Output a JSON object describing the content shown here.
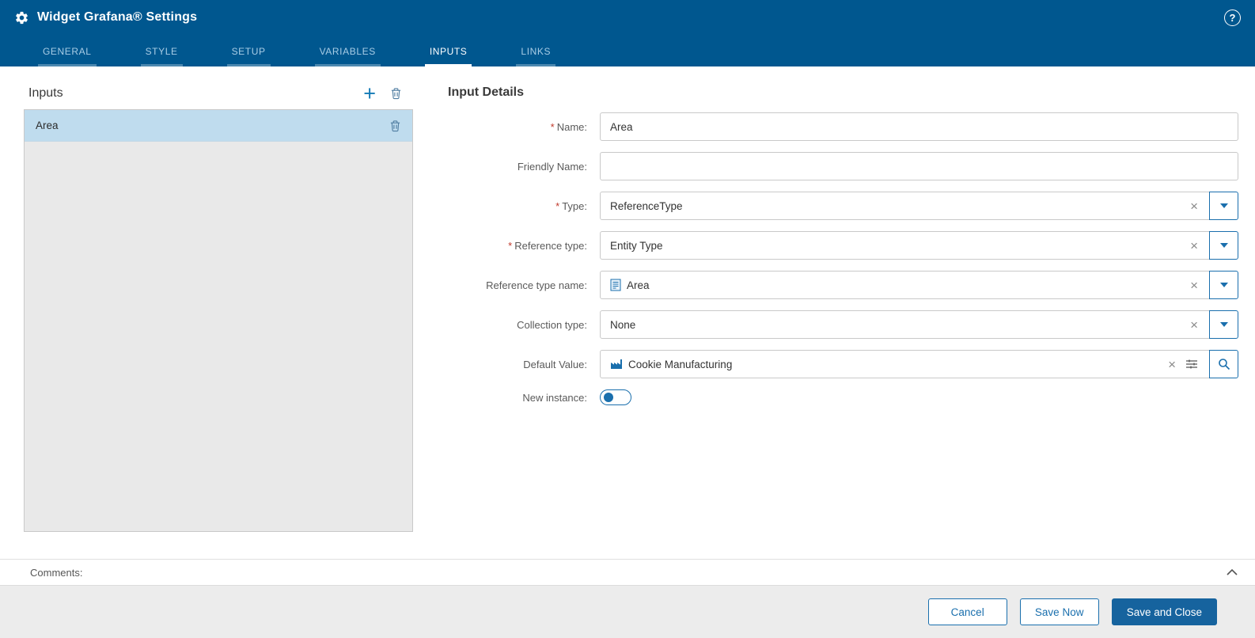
{
  "colors": {
    "header_bg": "#00578F",
    "accent_blue": "#1A6FAD",
    "selected_item_bg": "#BFDCEE",
    "primary_button_bg": "#16639E",
    "required_red": "#C0392B"
  },
  "header": {
    "title": "Widget Grafana® Settings",
    "help_label": "?"
  },
  "tabs": [
    {
      "label": "GENERAL",
      "active": false
    },
    {
      "label": "STYLE",
      "active": false
    },
    {
      "label": "SETUP",
      "active": false
    },
    {
      "label": "VARIABLES",
      "active": false
    },
    {
      "label": "INPUTS",
      "active": true
    },
    {
      "label": "LINKS",
      "active": false
    }
  ],
  "inputs_panel": {
    "title": "Inputs",
    "items": [
      {
        "label": "Area",
        "selected": true
      }
    ]
  },
  "details": {
    "title": "Input Details",
    "clear_symbol": "×",
    "fields": [
      {
        "label": "Name:",
        "required_marker": "*",
        "value": "Area",
        "control": "text"
      },
      {
        "label": "Friendly Name:",
        "required_marker": "",
        "value": "",
        "control": "text"
      },
      {
        "label": "Type:",
        "required_marker": "*",
        "value": "ReferenceType",
        "control": "combobox"
      },
      {
        "label": "Reference type:",
        "required_marker": "*",
        "value": "Entity Type",
        "control": "combobox"
      },
      {
        "label": "Reference type name:",
        "required_marker": "",
        "value": "Area",
        "control": "combobox",
        "icon": "datashape-icon"
      },
      {
        "label": "Collection type:",
        "required_marker": "",
        "value": "None",
        "control": "combobox"
      },
      {
        "label": "Default Value:",
        "required_marker": "",
        "value": "Cookie Manufacturing",
        "control": "entity-picker",
        "icon": "factory-icon"
      },
      {
        "label": "New instance:",
        "required_marker": "",
        "value": "off",
        "control": "toggle"
      }
    ]
  },
  "comments": {
    "label": "Comments:"
  },
  "footer": {
    "buttons": [
      {
        "label": "Cancel",
        "style": "outline"
      },
      {
        "label": "Save Now",
        "style": "outline"
      },
      {
        "label": "Save and Close",
        "style": "primary"
      }
    ]
  }
}
